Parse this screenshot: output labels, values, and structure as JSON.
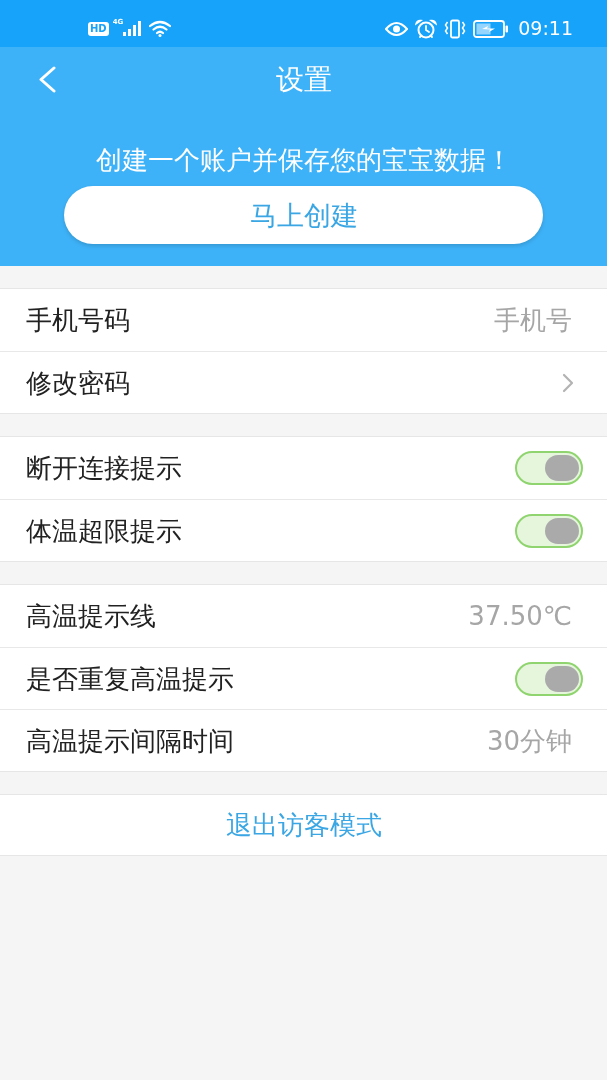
{
  "status_bar": {
    "hd_badge": "HD",
    "network": "4G",
    "time": "09:11"
  },
  "header": {
    "title": "设置",
    "prompt": "创建一个账户并保存您的宝宝数据！",
    "create_button": "马上创建"
  },
  "sections": [
    {
      "rows": [
        {
          "kind": "value",
          "label": "手机号码",
          "value": "手机号"
        },
        {
          "kind": "link",
          "label": "修改密码"
        }
      ]
    },
    {
      "rows": [
        {
          "kind": "toggle",
          "label": "断开连接提示",
          "on": true
        },
        {
          "kind": "toggle",
          "label": "体温超限提示",
          "on": true
        }
      ]
    },
    {
      "rows": [
        {
          "kind": "value",
          "label": "高温提示线",
          "value": "37.50℃"
        },
        {
          "kind": "toggle",
          "label": "是否重复高温提示",
          "on": true
        },
        {
          "kind": "value",
          "label": "高温提示间隔时间",
          "value": "30分钟"
        }
      ]
    }
  ],
  "exit_button": "退出访客模式"
}
